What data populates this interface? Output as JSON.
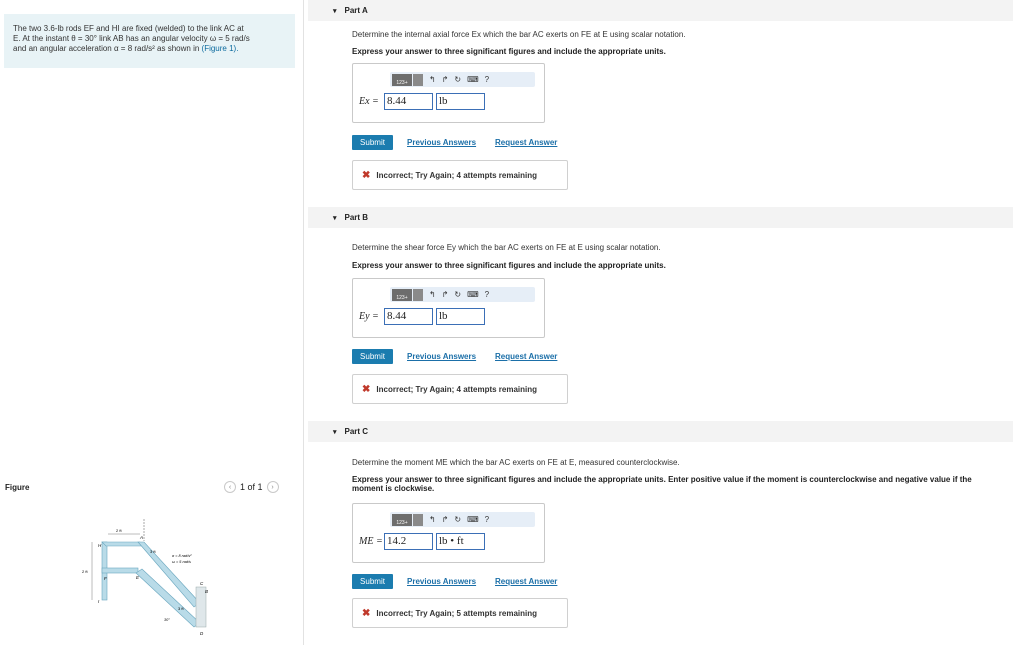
{
  "problem": {
    "line1": "The two 3.6-lb rods EF and HI are fixed (welded) to the link AC at",
    "line2": "E. At the instant θ = 30° link AB has an angular velocity ω = 5 rad/s",
    "line3": "and an angular acceleration α = 8 rad/s² as shown in",
    "figure_link": "(Figure 1)."
  },
  "figure": {
    "label": "Figure",
    "pager": "1 of 1",
    "prev_icon": "chevron-left-icon",
    "next_icon": "chevron-right-icon",
    "labels": {
      "H": "H",
      "I": "I",
      "F": "F",
      "E": "E",
      "C": "C",
      "A": "A",
      "B": "B",
      "D": "D",
      "dim_2ft_top": "2 ft",
      "dim_2ft_side": "2 ft",
      "dim_3ft": "3 ft",
      "dim_3ft_b": "3 ft",
      "alpha": "α = 8 rad/s²",
      "omega": "ω = 5 rad/s",
      "theta": "30°"
    }
  },
  "parts": [
    {
      "title": "Part A",
      "question": "Determine the internal axial force Ex which the bar AC exerts on FE at E using scalar notation.",
      "instruction": "Express your answer to three significant figures and include the appropriate units.",
      "variable": "Ex =",
      "value": "8.44",
      "unit": "lb",
      "toolbar_template": "123+",
      "submit": "Submit",
      "previous": "Previous Answers",
      "request": "Request Answer",
      "feedback": "Incorrect; Try Again; 4 attempts remaining"
    },
    {
      "title": "Part B",
      "question": "Determine the shear force Ey which the bar AC exerts on FE at E using scalar notation.",
      "instruction": "Express your answer to three significant figures and include the appropriate units.",
      "variable": "Ey =",
      "value": "8.44",
      "unit": "lb",
      "toolbar_template": "123+",
      "submit": "Submit",
      "previous": "Previous Answers",
      "request": "Request Answer",
      "feedback": "Incorrect; Try Again; 4 attempts remaining"
    },
    {
      "title": "Part C",
      "question": "Determine the moment ME which the bar AC exerts on FE at E, measured counterclockwise.",
      "instruction": "Express your answer to three significant figures and include the appropriate units. Enter positive value if the moment is counterclockwise and negative value if the moment is clockwise.",
      "variable": "ME =",
      "value": "14.2",
      "unit": "lb • ft",
      "toolbar_template": "123+",
      "submit": "Submit",
      "previous": "Previous Answers",
      "request": "Request Answer",
      "feedback": "Incorrect; Try Again; 5 attempts remaining"
    }
  ],
  "toolbar_icons": [
    "undo-icon",
    "redo-icon",
    "reset-icon",
    "keyboard-icon",
    "help-icon"
  ],
  "toolbar_glyphs": {
    "undo": "↰",
    "redo": "↱",
    "reset": "↻",
    "keyboard": "⌨",
    "help": "?"
  },
  "colors": {
    "submit": "#1b7caf",
    "link": "#1b6fa8",
    "error": "#c0392b",
    "problem_bg": "#e8f3f6"
  }
}
